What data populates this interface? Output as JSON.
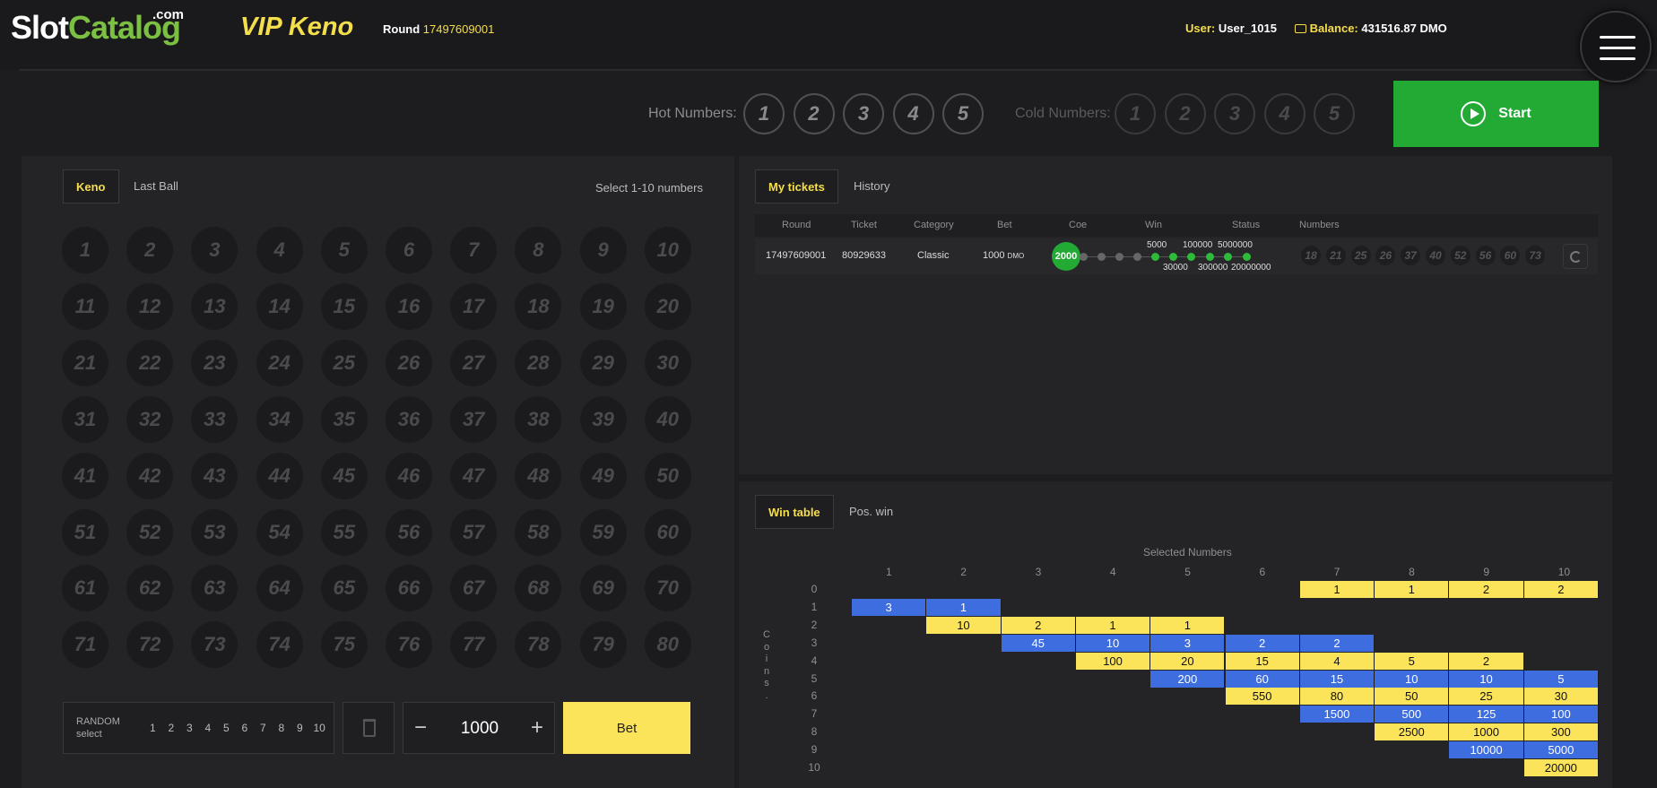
{
  "header": {
    "logo": {
      "part1": "Slot",
      "part2": "Catalog",
      "suffix": ".com"
    },
    "game_title": "VIP Keno",
    "round_label": "Round",
    "round_value": "17497609001",
    "user_label": "User:",
    "user_value": "User_1015",
    "balance_label": "Balance:",
    "balance_value": "431516.87 DMO",
    "menu_icon": "hamburger-icon"
  },
  "hot_numbers": {
    "label": "Hot Numbers:",
    "values": [
      "1",
      "2",
      "3",
      "4",
      "5"
    ]
  },
  "cold_numbers": {
    "label": "Cold Numbers:",
    "values": [
      "1",
      "2",
      "3",
      "4",
      "5"
    ]
  },
  "start_button": {
    "label": "Start",
    "icon": "play-icon"
  },
  "left_panel": {
    "tabs": [
      "Keno",
      "Last Ball"
    ],
    "active_tab": "Keno",
    "hint": "Select 1-10 numbers",
    "random": {
      "title": "RANDOM",
      "subtitle": "select",
      "options": [
        "1",
        "2",
        "3",
        "4",
        "5",
        "6",
        "7",
        "8",
        "9",
        "10"
      ]
    },
    "trash_icon": "trash-icon",
    "bet_amount": "1000",
    "minus_symbol": "−",
    "plus_symbol": "+",
    "bet_label": "Bet"
  },
  "tickets_panel": {
    "tabs": [
      "My tickets",
      "History"
    ],
    "active_tab": "My tickets",
    "columns": [
      "Round",
      "Ticket",
      "Category",
      "Bet",
      "Coe",
      "Win",
      "Status",
      "Numbers"
    ],
    "rows": [
      {
        "round": "17497609001",
        "ticket": "80929633",
        "category": "Classic",
        "bet": "1000",
        "bet_unit": "DMO",
        "coe": "2000",
        "ladder_top": [
          "5000",
          "100000",
          "5000000"
        ],
        "ladder_bottom": [
          "30000",
          "300000",
          "20000000"
        ],
        "numbers": [
          "18",
          "21",
          "25",
          "26",
          "37",
          "40",
          "52",
          "56",
          "60",
          "73"
        ],
        "action_icon": "refresh-icon"
      }
    ]
  },
  "win_table": {
    "tabs": [
      "Win table",
      "Pos. win"
    ],
    "active_tab": "Win table",
    "x_title": "Selected Numbers",
    "y_title": "Coins.",
    "columns": [
      "1",
      "2",
      "3",
      "4",
      "5",
      "6",
      "7",
      "8",
      "9",
      "10"
    ],
    "rows": [
      "0",
      "1",
      "2",
      "3",
      "4",
      "5",
      "6",
      "7",
      "8",
      "9",
      "10"
    ],
    "colors": {
      "yellow": "#fbe35a",
      "blue": "#3e6de0"
    },
    "cells": [
      {
        "r": 0,
        "c": 7,
        "v": "1",
        "t": "y"
      },
      {
        "r": 0,
        "c": 8,
        "v": "1",
        "t": "y"
      },
      {
        "r": 0,
        "c": 9,
        "v": "2",
        "t": "y"
      },
      {
        "r": 0,
        "c": 10,
        "v": "2",
        "t": "y"
      },
      {
        "r": 1,
        "c": 1,
        "v": "3",
        "t": "b"
      },
      {
        "r": 1,
        "c": 2,
        "v": "1",
        "t": "b"
      },
      {
        "r": 2,
        "c": 2,
        "v": "10",
        "t": "y"
      },
      {
        "r": 2,
        "c": 3,
        "v": "2",
        "t": "y"
      },
      {
        "r": 2,
        "c": 4,
        "v": "1",
        "t": "y"
      },
      {
        "r": 2,
        "c": 5,
        "v": "1",
        "t": "y"
      },
      {
        "r": 3,
        "c": 3,
        "v": "45",
        "t": "b"
      },
      {
        "r": 3,
        "c": 4,
        "v": "10",
        "t": "b"
      },
      {
        "r": 3,
        "c": 5,
        "v": "3",
        "t": "b"
      },
      {
        "r": 3,
        "c": 6,
        "v": "2",
        "t": "b"
      },
      {
        "r": 3,
        "c": 7,
        "v": "2",
        "t": "b"
      },
      {
        "r": 4,
        "c": 4,
        "v": "100",
        "t": "y"
      },
      {
        "r": 4,
        "c": 5,
        "v": "20",
        "t": "y"
      },
      {
        "r": 4,
        "c": 6,
        "v": "15",
        "t": "y"
      },
      {
        "r": 4,
        "c": 7,
        "v": "4",
        "t": "y"
      },
      {
        "r": 4,
        "c": 8,
        "v": "5",
        "t": "y"
      },
      {
        "r": 4,
        "c": 9,
        "v": "2",
        "t": "y"
      },
      {
        "r": 5,
        "c": 5,
        "v": "200",
        "t": "b"
      },
      {
        "r": 5,
        "c": 6,
        "v": "60",
        "t": "b"
      },
      {
        "r": 5,
        "c": 7,
        "v": "15",
        "t": "b"
      },
      {
        "r": 5,
        "c": 8,
        "v": "10",
        "t": "b"
      },
      {
        "r": 5,
        "c": 9,
        "v": "10",
        "t": "b"
      },
      {
        "r": 5,
        "c": 10,
        "v": "5",
        "t": "b"
      },
      {
        "r": 6,
        "c": 6,
        "v": "550",
        "t": "y"
      },
      {
        "r": 6,
        "c": 7,
        "v": "80",
        "t": "y"
      },
      {
        "r": 6,
        "c": 8,
        "v": "50",
        "t": "y"
      },
      {
        "r": 6,
        "c": 9,
        "v": "25",
        "t": "y"
      },
      {
        "r": 6,
        "c": 10,
        "v": "30",
        "t": "y"
      },
      {
        "r": 7,
        "c": 7,
        "v": "1500",
        "t": "b"
      },
      {
        "r": 7,
        "c": 8,
        "v": "500",
        "t": "b"
      },
      {
        "r": 7,
        "c": 9,
        "v": "125",
        "t": "b"
      },
      {
        "r": 7,
        "c": 10,
        "v": "100",
        "t": "b"
      },
      {
        "r": 8,
        "c": 8,
        "v": "2500",
        "t": "y"
      },
      {
        "r": 8,
        "c": 9,
        "v": "1000",
        "t": "y"
      },
      {
        "r": 8,
        "c": 10,
        "v": "300",
        "t": "y"
      },
      {
        "r": 9,
        "c": 9,
        "v": "10000",
        "t": "b"
      },
      {
        "r": 9,
        "c": 10,
        "v": "5000",
        "t": "b"
      },
      {
        "r": 10,
        "c": 10,
        "v": "20000",
        "t": "y"
      }
    ]
  },
  "colors": {
    "accent_yellow": "#f5de4c",
    "start_green": "#22aa34",
    "bet_yellow": "#fbe35a"
  }
}
